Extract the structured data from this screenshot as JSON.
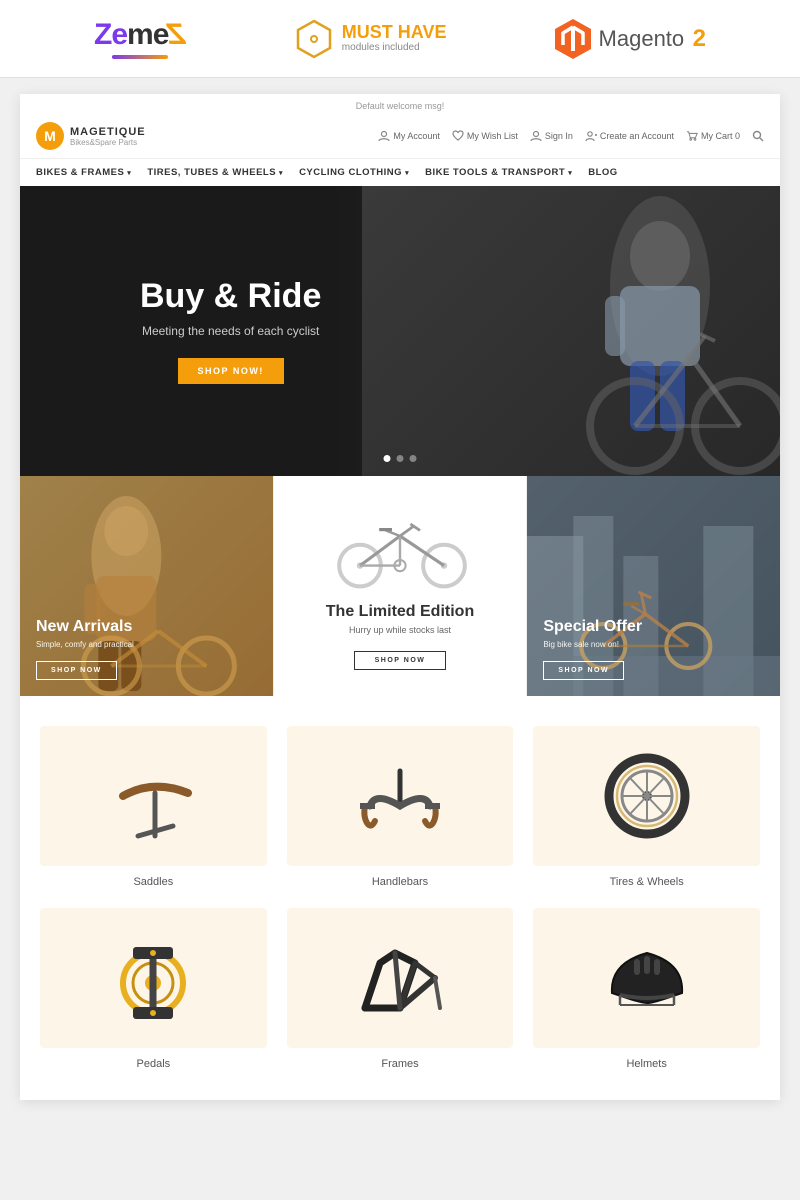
{
  "topBanner": {
    "zemesLogo": "ZemeZ",
    "mustHave": {
      "line1": "MUST HAVE",
      "line2": "modules included"
    },
    "magento": {
      "text": "Magento",
      "version": "2"
    }
  },
  "site": {
    "welcomeMsg": "Default welcome msg!",
    "brand": {
      "name": "MAGETIQUE",
      "sub": "Bikes&Spare Parts"
    },
    "headerActions": [
      {
        "label": "My Account"
      },
      {
        "label": "My Wish List"
      },
      {
        "label": "Sign In"
      },
      {
        "label": "Create an Account"
      },
      {
        "label": "My Cart  0"
      }
    ],
    "nav": [
      {
        "label": "Bikes & Frames",
        "hasArrow": true
      },
      {
        "label": "Tires, Tubes & Wheels",
        "hasArrow": true
      },
      {
        "label": "Cycling Clothing",
        "hasArrow": true
      },
      {
        "label": "Bike Tools & Transport",
        "hasArrow": true
      },
      {
        "label": "Blog",
        "hasArrow": false
      }
    ],
    "hero": {
      "title": "Buy & Ride",
      "subtitle": "Meeting the needs of each cyclist",
      "btn": "SHOP NOW!",
      "dots": [
        true,
        false,
        false
      ]
    },
    "panels": [
      {
        "id": "left",
        "title": "New Arrivals",
        "desc": "Simple, comfy and practical",
        "btn": "SHOP NOW"
      },
      {
        "id": "center",
        "title": "The Limited Edition",
        "sub": "Hurry up while stocks last",
        "btn": "SHOP NOW"
      },
      {
        "id": "right",
        "title": "Special Offer",
        "desc": "Big bike sale now on!",
        "btn": "SHOP NOW"
      }
    ],
    "categories": [
      {
        "label": "Saddles",
        "color": "#fdf6e8"
      },
      {
        "label": "Handlebars",
        "color": "#fdf6e8"
      },
      {
        "label": "Tires & Wheels",
        "color": "#fdf6e8"
      },
      {
        "label": "Pedals",
        "color": "#fdf6e8"
      },
      {
        "label": "Frames",
        "color": "#fdf6e8"
      },
      {
        "label": "Helmets",
        "color": "#fdf6e8"
      }
    ]
  }
}
